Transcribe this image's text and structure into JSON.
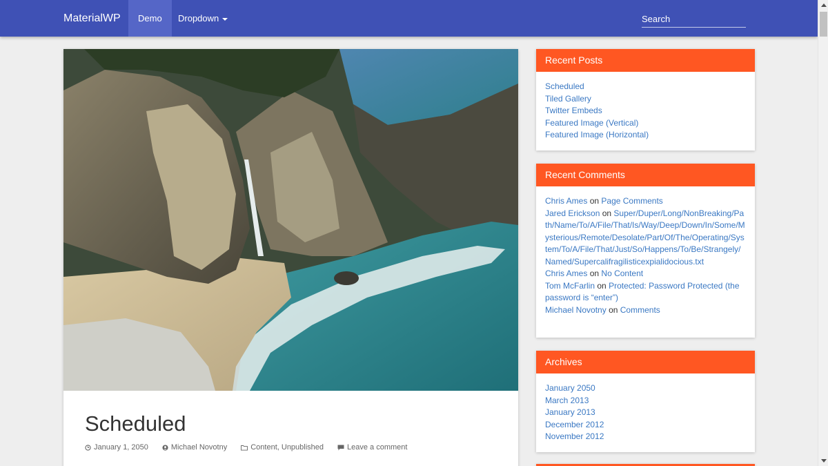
{
  "navbar": {
    "brand": "MaterialWP",
    "items": [
      {
        "label": "Demo",
        "active": true
      },
      {
        "label": "Dropdown",
        "has_caret": true
      }
    ],
    "search_placeholder": "Search",
    "color": "#3f51b5"
  },
  "post": {
    "title": "Scheduled",
    "date": "January 1, 2050",
    "author": "Michael Novotny",
    "categories": [
      "Content",
      "Unpublished"
    ],
    "category_separator": ",",
    "comment_link": "Leave a comment"
  },
  "sidebar": {
    "accent": "#ff5722",
    "recent_posts": {
      "title": "Recent Posts",
      "items": [
        "Scheduled",
        "Tiled Gallery",
        "Twitter Embeds",
        "Featured Image (Vertical)",
        "Featured Image (Horizontal)"
      ]
    },
    "recent_comments": {
      "title": "Recent Comments",
      "on_word": "on",
      "items": [
        {
          "author": "Chris Ames",
          "post": "Page Comments"
        },
        {
          "author": "Jared Erickson",
          "post": "Super/Duper/Long/NonBreaking/Path/Name/To/A/File/That/Is/Way/Deep/Down/In/Some/Mysterious/Remote/Desolate/Part/Of/The/Operating/System/To/A/File/That/Just/So/Happens/To/Be/Strangely/Named/Supercalifragilisticexpialidocious.txt"
        },
        {
          "author": "Chris Ames",
          "post": "No Content"
        },
        {
          "author": "Tom McFarlin",
          "post": "Protected: Password Protected (the password is “enter”)"
        },
        {
          "author": "Michael Novotny",
          "post": "Comments"
        }
      ]
    },
    "archives": {
      "title": "Archives",
      "items": [
        "January 2050",
        "March 2013",
        "January 2013",
        "December 2012",
        "November 2012"
      ]
    }
  }
}
